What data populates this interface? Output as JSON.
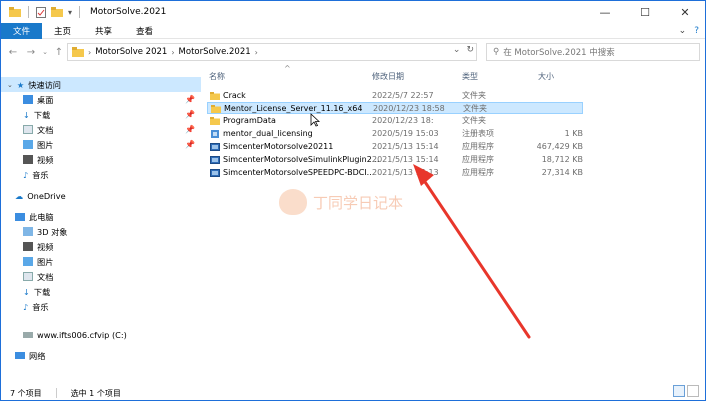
{
  "window": {
    "title": "MotorSolve.2021",
    "controls": [
      "—",
      "☐",
      "✕"
    ]
  },
  "ribbon": {
    "tabs": [
      "文件",
      "主页",
      "共享",
      "查看"
    ],
    "help": "?"
  },
  "address": {
    "crumbs": [
      "MotorSolve 2021",
      "MotorSolve.2021"
    ],
    "search_placeholder": "在 MotorSolve.2021 中搜索"
  },
  "nav": {
    "quick_access": "快速访问",
    "quick_items": [
      "桌面",
      "下载",
      "文档",
      "图片",
      "视频",
      "音乐"
    ],
    "onedrive": "OneDrive",
    "this_pc": "此电脑",
    "pc_items": [
      "3D 对象",
      "视频",
      "图片",
      "文档",
      "下载",
      "音乐",
      "www.ifts006.cfvip (C:)"
    ],
    "network": "网络"
  },
  "columns": {
    "name": "名称",
    "date": "修改日期",
    "type": "类型",
    "size": "大小"
  },
  "files": [
    {
      "name": "Crack",
      "date": "2022/5/7 22:57",
      "type": "文件夹",
      "size": "",
      "icon": "folder"
    },
    {
      "name": "Mentor_License_Server_11.16_x64",
      "date": "2020/12/23 18:58",
      "type": "文件夹",
      "size": "",
      "icon": "folder"
    },
    {
      "name": "ProgramData",
      "date": "2020/12/23 18:",
      "type": "文件夹",
      "size": "",
      "icon": "folder"
    },
    {
      "name": "mentor_dual_licensing",
      "date": "2020/5/19 15:03",
      "type": "注册表项",
      "size": "1 KB",
      "icon": "registry"
    },
    {
      "name": "SimcenterMotorsolve20211",
      "date": "2021/5/13 15:14",
      "type": "应用程序",
      "size": "467,429 KB",
      "icon": "exe"
    },
    {
      "name": "SimcenterMotorsolveSimulinkPlugin2...",
      "date": "2021/5/13 15:14",
      "type": "应用程序",
      "size": "18,712 KB",
      "icon": "exe"
    },
    {
      "name": "SimcenterMotorsolveSPEEDPC-BDCI...",
      "date": "2021/5/13 15:13",
      "type": "应用程序",
      "size": "27,314 KB",
      "icon": "exe"
    }
  ],
  "status": {
    "count": "7 个项目",
    "selected": "选中 1 个项目"
  },
  "watermark": "丁同学日记本",
  "colors": {
    "accent": "#1979ca",
    "selection": "#cce8ff",
    "folder": "#f5c84c",
    "arrow": "#e8362b"
  }
}
